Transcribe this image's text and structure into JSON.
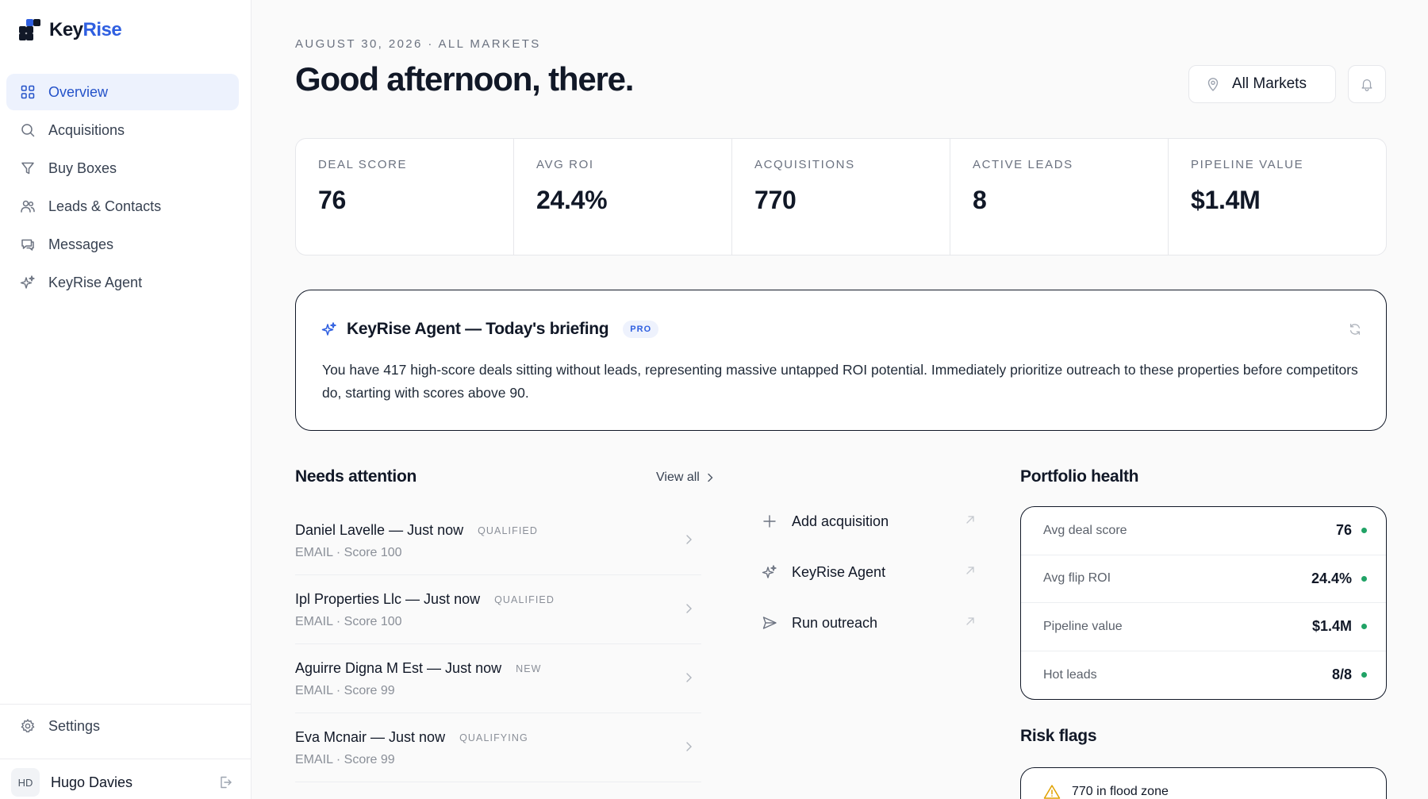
{
  "brand": {
    "name_primary": "Key",
    "name_accent": "Rise",
    "accent_color": "#2f5fe0"
  },
  "sidebar": {
    "items": [
      {
        "label": "Overview",
        "icon": "grid-icon",
        "active": true
      },
      {
        "label": "Acquisitions",
        "icon": "search-icon"
      },
      {
        "label": "Buy Boxes",
        "icon": "filter-icon"
      },
      {
        "label": "Leads & Contacts",
        "icon": "users-icon"
      },
      {
        "label": "Messages",
        "icon": "chat-icon"
      },
      {
        "label": "KeyRise Agent",
        "icon": "sparkle-icon"
      }
    ],
    "settings_label": "Settings",
    "user": {
      "initials": "HD",
      "name": "Hugo Davies"
    }
  },
  "header": {
    "date_line": "AUGUST 30, 2026 · ALL MARKETS",
    "greeting": "Good afternoon, there.",
    "market_selector": "All Markets"
  },
  "kpis": [
    {
      "label": "DEAL SCORE",
      "value": "76"
    },
    {
      "label": "AVG ROI",
      "value": "24.4%"
    },
    {
      "label": "ACQUISITIONS",
      "value": "770"
    },
    {
      "label": "ACTIVE LEADS",
      "value": "8"
    },
    {
      "label": "PIPELINE VALUE",
      "value": "$1.4M"
    }
  ],
  "briefing": {
    "title": "KeyRise Agent — Today's briefing",
    "badge": "PRO",
    "text": "You have 417 high-score deals sitting without leads, representing massive untapped ROI potential. Immediately prioritize outreach to these properties before competitors do, starting with scores above 90."
  },
  "needs_attention": {
    "title": "Needs attention",
    "view_all": "View all",
    "items": [
      {
        "name": "Daniel Lavelle — Just now",
        "status": "QUALIFIED",
        "sub": "EMAIL · Score 100"
      },
      {
        "name": "Ipl Properties Llc — Just now",
        "status": "QUALIFIED",
        "sub": "EMAIL · Score 100"
      },
      {
        "name": "Aguirre Digna M Est — Just now",
        "status": "NEW",
        "sub": "EMAIL · Score 99"
      },
      {
        "name": "Eva Mcnair — Just now",
        "status": "QUALIFYING",
        "sub": "EMAIL · Score 99"
      }
    ]
  },
  "quick_actions": [
    {
      "label": "Add acquisition",
      "icon": "plus-icon"
    },
    {
      "label": "KeyRise Agent",
      "icon": "sparkle-icon"
    },
    {
      "label": "Run outreach",
      "icon": "send-icon"
    }
  ],
  "portfolio_health": {
    "title": "Portfolio health",
    "rows": [
      {
        "label": "Avg deal score",
        "value": "76"
      },
      {
        "label": "Avg flip ROI",
        "value": "24.4%"
      },
      {
        "label": "Pipeline value",
        "value": "$1.4M"
      },
      {
        "label": "Hot leads",
        "value": "8/8"
      }
    ],
    "status_color": "#21a366"
  },
  "risk_flags": {
    "title": "Risk flags",
    "items": [
      {
        "label": "770 in flood zone",
        "icon": "warning-icon"
      }
    ]
  }
}
